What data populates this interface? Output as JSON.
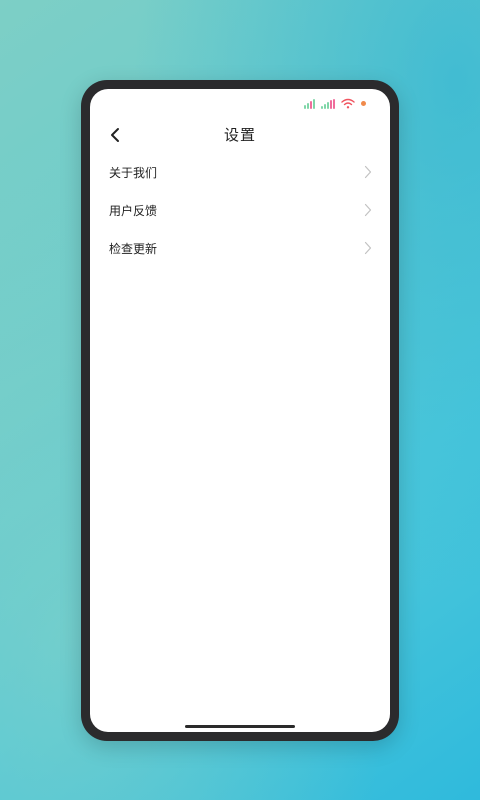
{
  "header": {
    "title": "设置",
    "back_icon": "chevron-left-icon"
  },
  "status_bar": {
    "icons": [
      "signal-icon",
      "signal-icon",
      "wifi-icon",
      "battery-icon"
    ],
    "colors": {
      "signal": "#7fd6a8",
      "signal_alt": "#f06c9b",
      "wifi": "#f0545f",
      "battery": "#f08a4b"
    }
  },
  "menu": {
    "items": [
      {
        "label": "关于我们",
        "icon": "chevron-right-icon"
      },
      {
        "label": "用户反馈",
        "icon": "chevron-right-icon"
      },
      {
        "label": "检查更新",
        "icon": "chevron-right-icon"
      }
    ]
  }
}
